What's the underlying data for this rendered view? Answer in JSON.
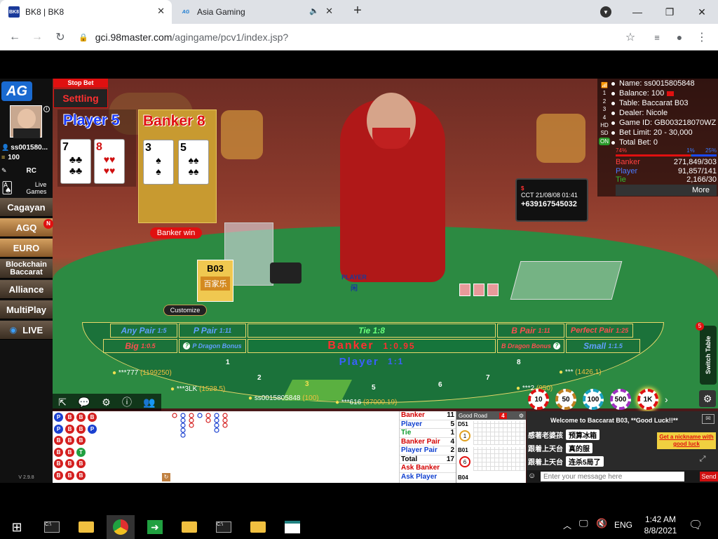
{
  "browser": {
    "tabs": [
      {
        "favicon": "BK8",
        "title": "BK8 | BK8"
      },
      {
        "favicon": "AG",
        "title": "Asia Gaming"
      }
    ],
    "url_host": "gci.98master.com",
    "url_path": "/agingame/pcv1/index.jsp?"
  },
  "game": {
    "stop_bet": "Stop Bet",
    "settings": "Settling",
    "player_label": "Player",
    "player_score": "5",
    "banker_label": "Banker",
    "banker_score": "8",
    "player_cards": [
      "7",
      "8"
    ],
    "banker_cards": [
      "3",
      "5"
    ],
    "result": "Banker win",
    "table_sign": "B03",
    "table_sign_cn": "百家乐",
    "customize": "Customize",
    "screen_time": "CCT 21/08/08 01:41",
    "screen_phone": "+639167545032",
    "table_label_top": "PLAYER",
    "table_label_cn": "闲"
  },
  "sidebar": {
    "user": "ss001580...",
    "balance": "100",
    "rc": "RC",
    "live_games": "Live Games",
    "items": [
      "Cagayan",
      "AGQ",
      "EURO",
      "Blockchain Baccarat",
      "Alliance",
      "MultiPlay",
      "LIVE"
    ],
    "badge": "N",
    "version": "V 2.9.8"
  },
  "info": {
    "name": "Name: ss0015805848",
    "balance": "Balance: 100",
    "table": "Table: Baccarat B03",
    "dealer": "Dealer: Nicole",
    "game_id": "Game ID: GB003218070WZ",
    "bet_limit": "Bet Limit: 20 - 30,000",
    "total_bet": "Total Bet: 0",
    "pct_left": "74%",
    "pct_mid": "1%",
    "pct_right": "25%",
    "banker_label": "Banker",
    "banker_val": "271,849/303",
    "player_label": "Player",
    "player_val": "91,857/141",
    "tie_label": "Tie",
    "tie_val": "2,166/30",
    "more": "More",
    "side_nums": [
      "1",
      "2",
      "3",
      "4",
      "HD",
      "SD",
      "ON"
    ]
  },
  "bets": {
    "any_pair": "Any Pair",
    "any_pair_odds": "1:5",
    "p_pair": "P Pair",
    "p_pair_odds": "1:11",
    "tie": "Tie",
    "tie_odds": "1:8",
    "b_pair": "B Pair",
    "b_pair_odds": "1:11",
    "perfect_pair": "Perfect Pair",
    "perfect_pair_odds": "1:25",
    "big": "Big",
    "big_odds": "1:0.5",
    "p_dragon": "P Dragon Bonus",
    "banker": "Banker",
    "banker_odds": "1:0.95",
    "b_dragon": "B Dragon Bonus",
    "small": "Small",
    "small_odds": "1:1.5",
    "player": "Player",
    "player_odds": "1:1",
    "seats": [
      "1",
      "2",
      "3",
      "5",
      "6",
      "7",
      "8"
    ],
    "players": [
      {
        "name": "***777",
        "amt": "(1199250)"
      },
      {
        "name": "***3LK",
        "amt": "(1528.5)"
      },
      {
        "name": "ss0015805848",
        "amt": "(100)"
      },
      {
        "name": "***616",
        "amt": "(37000.19)"
      },
      {
        "name": "***2",
        "amt": "(950)"
      },
      {
        "name": "***",
        "amt": "(1426.1)"
      }
    ],
    "switch_table": "Switch Table",
    "switch_badge": "5"
  },
  "chips": [
    "10",
    "50",
    "100",
    "500",
    "1K"
  ],
  "stats": {
    "rows": [
      {
        "label": "Banker",
        "val": "11",
        "color": "#d40000"
      },
      {
        "label": "Player",
        "val": "5",
        "color": "#1040d0"
      },
      {
        "label": "Tie",
        "val": "1",
        "color": "#0a9a2a"
      },
      {
        "label": "Banker Pair",
        "val": "4",
        "color": "#d40000"
      },
      {
        "label": "Player Pair",
        "val": "2",
        "color": "#1040d0"
      },
      {
        "label": "Total",
        "val": "17",
        "color": "#000000"
      },
      {
        "label": "Ask Banker",
        "val": "",
        "color": "#d40000"
      },
      {
        "label": "Ask Player",
        "val": "",
        "color": "#1040d0"
      }
    ],
    "good_road": "Good Road",
    "good_road_count": "4",
    "road_tables": [
      "D51",
      "B01",
      "B04"
    ],
    "road_nums": [
      "1",
      "6"
    ]
  },
  "chat": {
    "welcome": "Welcome to Baccarat B03, **Good Luck!!**",
    "messages": [
      {
        "from": "感著老婆孩",
        "text": "预算冰箱"
      },
      {
        "from": "跟着上天台",
        "text": "真的服"
      },
      {
        "from": "跟着上天台",
        "text": "连杀5局了"
      }
    ],
    "nickname": "Get a nickname with good luck",
    "placeholder": "Enter your message here",
    "send": "Send"
  },
  "beads": [
    "P",
    "P",
    "B",
    "B",
    "B",
    "B",
    "B",
    "B",
    "B",
    "B",
    "B",
    "B",
    "B",
    "B",
    "B",
    "T",
    "B",
    "B",
    "B",
    "P"
  ],
  "taskbar": {
    "lang": "ENG",
    "time": "1:42 AM",
    "date": "8/8/2021"
  }
}
